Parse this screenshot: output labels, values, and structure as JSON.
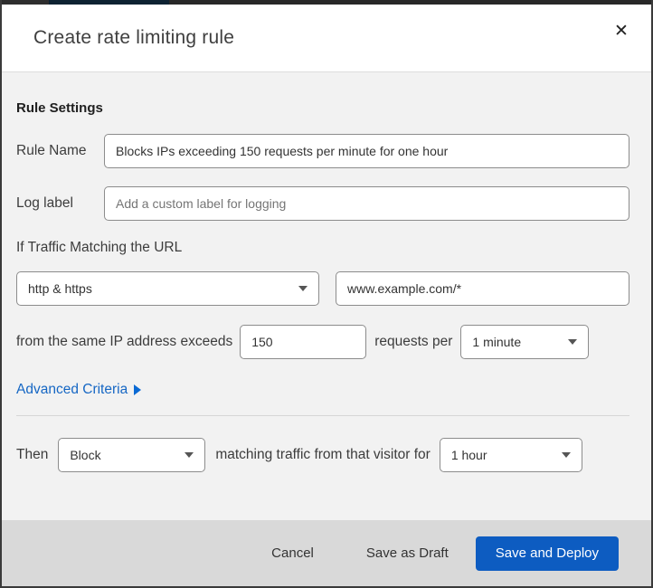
{
  "dialog": {
    "title": "Create rate limiting rule",
    "close_glyph": "✕"
  },
  "form": {
    "section_heading": "Rule Settings",
    "rule_name": {
      "label": "Rule Name",
      "value": "Blocks IPs exceeding 150 requests per minute for one hour"
    },
    "log_label": {
      "label": "Log label",
      "placeholder": "Add a custom label for logging"
    },
    "traffic_match": {
      "heading": "If Traffic Matching the URL",
      "scheme_selected": "http & https",
      "url_value": "www.example.com/*"
    },
    "threshold": {
      "prefix_text": "from the same IP address exceeds",
      "requests_value": "150",
      "middle_text": "requests per",
      "period_selected": "1 minute"
    },
    "advanced_criteria_label": "Advanced Criteria",
    "action": {
      "then_label": "Then",
      "action_selected": "Block",
      "middle_text": "matching traffic from that visitor for",
      "duration_selected": "1 hour"
    }
  },
  "footer": {
    "cancel_label": "Cancel",
    "save_draft_label": "Save as Draft",
    "save_deploy_label": "Save and Deploy"
  },
  "colors": {
    "accent_blue": "#0d5cc1",
    "link_blue": "#1667c4",
    "body_bg": "#f2f2f2",
    "footer_bg": "#d9d9d9",
    "input_border": "#8c8c8c"
  }
}
